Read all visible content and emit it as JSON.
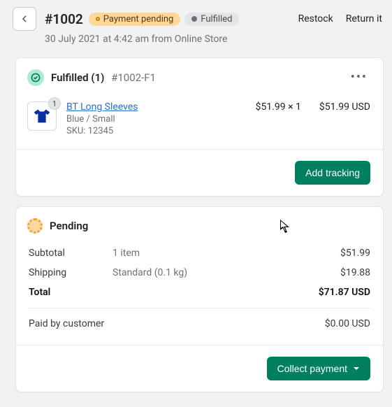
{
  "header": {
    "order_number": "#1002",
    "payment_badge": "Payment pending",
    "fulfillment_badge": "Fulfilled",
    "restock": "Restock",
    "return": "Return it",
    "timestamp": "30 July 2021 at 4:42 am from Online Store"
  },
  "fulfillment_card": {
    "title": "Fulfilled (1)",
    "ref": "#1002-F1",
    "item": {
      "badge_qty": "1",
      "name": "BT Long Sleeves",
      "variant": "Blue / Small",
      "sku": "SKU: 12345",
      "unit_price": "$51.99 × 1",
      "line_total": "$51.99 USD"
    },
    "add_tracking": "Add tracking"
  },
  "payment_card": {
    "title": "Pending",
    "rows": {
      "subtotal_label": "Subtotal",
      "subtotal_desc": "1 item",
      "subtotal_val": "$51.99",
      "shipping_label": "Shipping",
      "shipping_desc": "Standard (0.1 kg)",
      "shipping_val": "$19.88",
      "total_label": "Total",
      "total_val": "$71.87 USD",
      "paid_label": "Paid by customer",
      "paid_val": "$0.00 USD"
    },
    "collect": "Collect payment"
  }
}
